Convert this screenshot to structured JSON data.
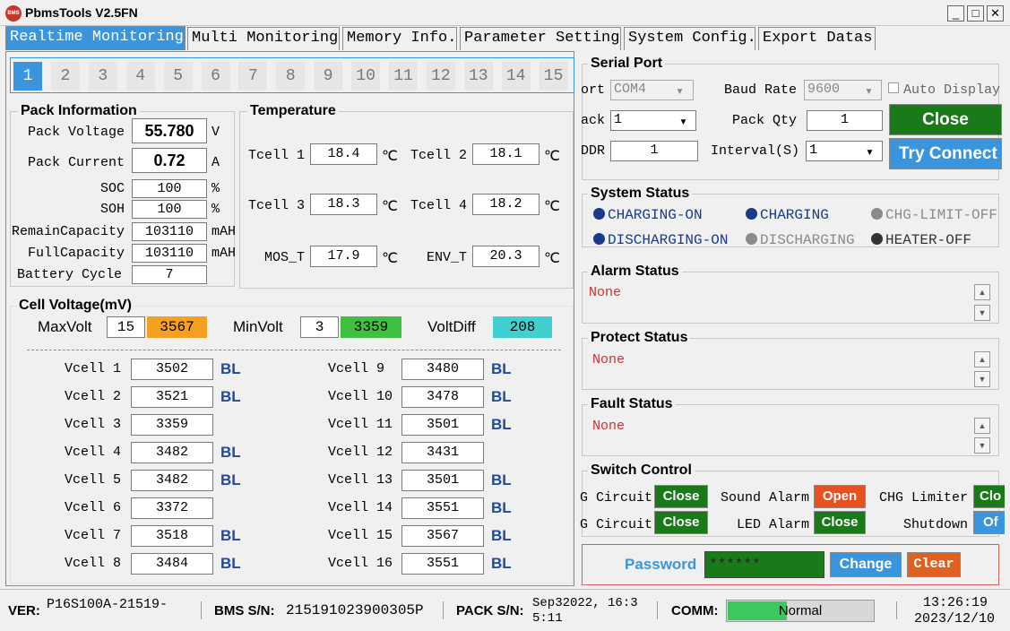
{
  "window": {
    "title": "PbmsTools V2.5FN",
    "logo_text": "BMS",
    "min": "_",
    "max": "□",
    "close": "✕"
  },
  "tabs": [
    "Realtime Monitoring",
    "Multi Monitoring",
    "Memory Info.",
    "Parameter Setting",
    "System Config.",
    "Export Datas"
  ],
  "packs": [
    "1",
    "2",
    "3",
    "4",
    "5",
    "6",
    "7",
    "8",
    "9",
    "10",
    "11",
    "12",
    "13",
    "14",
    "15"
  ],
  "pack_info": {
    "title": "Pack Information",
    "voltage_label": "Pack Voltage",
    "voltage": "55.780",
    "voltage_unit": "V",
    "current_label": "Pack Current",
    "current": "0.72",
    "current_unit": "A",
    "soc_label": "SOC",
    "soc": "100",
    "soc_unit": "%",
    "soh_label": "SOH",
    "soh": "100",
    "soh_unit": "%",
    "remain_label": "RemainCapacity",
    "remain": "103110",
    "remain_unit": "mAH",
    "full_label": "FullCapacity",
    "full": "103110",
    "full_unit": "mAH",
    "cycle_label": "Battery Cycle",
    "cycle": "7"
  },
  "temperature": {
    "title": "Temperature",
    "unit": "℃",
    "t1_label": "Tcell 1",
    "t1": "18.4",
    "t2_label": "Tcell 2",
    "t2": "18.1",
    "t3_label": "Tcell 3",
    "t3": "18.3",
    "t4_label": "Tcell 4",
    "t4": "18.2",
    "mos_label": "MOS_T",
    "mos": "17.9",
    "env_label": "ENV_T",
    "env": "20.3"
  },
  "cell": {
    "title": "Cell Voltage(mV)",
    "max_label": "MaxVolt",
    "max_idx": "15",
    "max_val": "3567",
    "min_label": "MinVolt",
    "min_idx": "3",
    "min_val": "3359",
    "diff_label": "VoltDiff",
    "diff_val": "208",
    "left": [
      {
        "label": "Vcell 1",
        "value": "3502",
        "bl": "BL"
      },
      {
        "label": "Vcell 2",
        "value": "3521",
        "bl": "BL"
      },
      {
        "label": "Vcell 3",
        "value": "3359",
        "bl": ""
      },
      {
        "label": "Vcell 4",
        "value": "3482",
        "bl": "BL"
      },
      {
        "label": "Vcell 5",
        "value": "3482",
        "bl": "BL"
      },
      {
        "label": "Vcell 6",
        "value": "3372",
        "bl": ""
      },
      {
        "label": "Vcell 7",
        "value": "3518",
        "bl": "BL"
      },
      {
        "label": "Vcell 8",
        "value": "3484",
        "bl": "BL"
      }
    ],
    "right": [
      {
        "label": "Vcell 9",
        "value": "3480",
        "bl": "BL"
      },
      {
        "label": "Vcell 10",
        "value": "3478",
        "bl": "BL"
      },
      {
        "label": "Vcell 11",
        "value": "3501",
        "bl": "BL"
      },
      {
        "label": "Vcell 12",
        "value": "3431",
        "bl": ""
      },
      {
        "label": "Vcell 13",
        "value": "3501",
        "bl": "BL"
      },
      {
        "label": "Vcell 14",
        "value": "3551",
        "bl": "BL"
      },
      {
        "label": "Vcell 15",
        "value": "3567",
        "bl": "BL"
      },
      {
        "label": "Vcell 16",
        "value": "3551",
        "bl": "BL"
      }
    ]
  },
  "serial": {
    "title": "Serial Port",
    "port_label": "ort",
    "port": "COM4",
    "baud_label": "Baud Rate",
    "baud": "9600",
    "auto_label": "Auto Display",
    "pack_label": "ack",
    "pack": "1",
    "qty_label": "Pack Qty",
    "qty": "1",
    "addr_label": "DDR",
    "addr": "1",
    "interval_label": "Interval(S)",
    "interval": "1",
    "close_btn": "Close",
    "connect_btn": "Try Connect"
  },
  "system_status": {
    "title": "System Status",
    "items": [
      {
        "label": "CHARGING-ON",
        "color": "#1a3a8a",
        "text_color": "#1a3a8a"
      },
      {
        "label": "CHARGING",
        "color": "#1a3a8a",
        "text_color": "#1a3a8a"
      },
      {
        "label": "CHG-LIMIT-OFF",
        "color": "#8a8a8a",
        "text_color": "#8a8a8a"
      },
      {
        "label": "DISCHARGING-ON",
        "color": "#1a3a8a",
        "text_color": "#1a3a8a"
      },
      {
        "label": "DISCHARGING",
        "color": "#8a8a8a",
        "text_color": "#8a8a8a"
      },
      {
        "label": "HEATER-OFF",
        "color": "#333333",
        "text_color": "#333333"
      }
    ]
  },
  "alarm": {
    "title": "Alarm Status",
    "value": "None"
  },
  "protect": {
    "title": "Protect Status",
    "value": "None"
  },
  "fault": {
    "title": "Fault Status",
    "value": "None"
  },
  "switch": {
    "title": "Switch Control",
    "c1_label": "G Circuit",
    "c1_btn": "Close",
    "sound_label": "Sound Alarm",
    "sound_btn": "Open",
    "limiter_label": "CHG Limiter",
    "limiter_btn": "Clo",
    "c2_label": "G Circuit",
    "c2_btn": "Close",
    "led_label": "LED Alarm",
    "led_btn": "Close",
    "shutdown_label": "Shutdown",
    "shutdown_btn": "Of"
  },
  "password": {
    "label": "Password",
    "value": "******",
    "change_btn": "Change",
    "clear_btn": "Clear"
  },
  "statusbar": {
    "ver_label": "VER:",
    "ver": "P16S100A-21519-",
    "bms_label": "BMS S/N:",
    "bms": "215191023900305P",
    "pack_label": "PACK S/N:",
    "pack_line1": "Sep32022, 16:3",
    "pack_line2": "5:11",
    "comm_label": "COMM:",
    "comm": "Normal",
    "comm_progress": 0.4,
    "time": "13:26:19",
    "date": "2023/12/10"
  },
  "colors": {
    "accent": "#3a95dc",
    "green_btn": "#1a7a1a",
    "orange": "#f5a020",
    "green_cell": "#40c040",
    "cyan": "#40d0d0",
    "red_btn": "#e85020",
    "red_text": "#d03030"
  }
}
